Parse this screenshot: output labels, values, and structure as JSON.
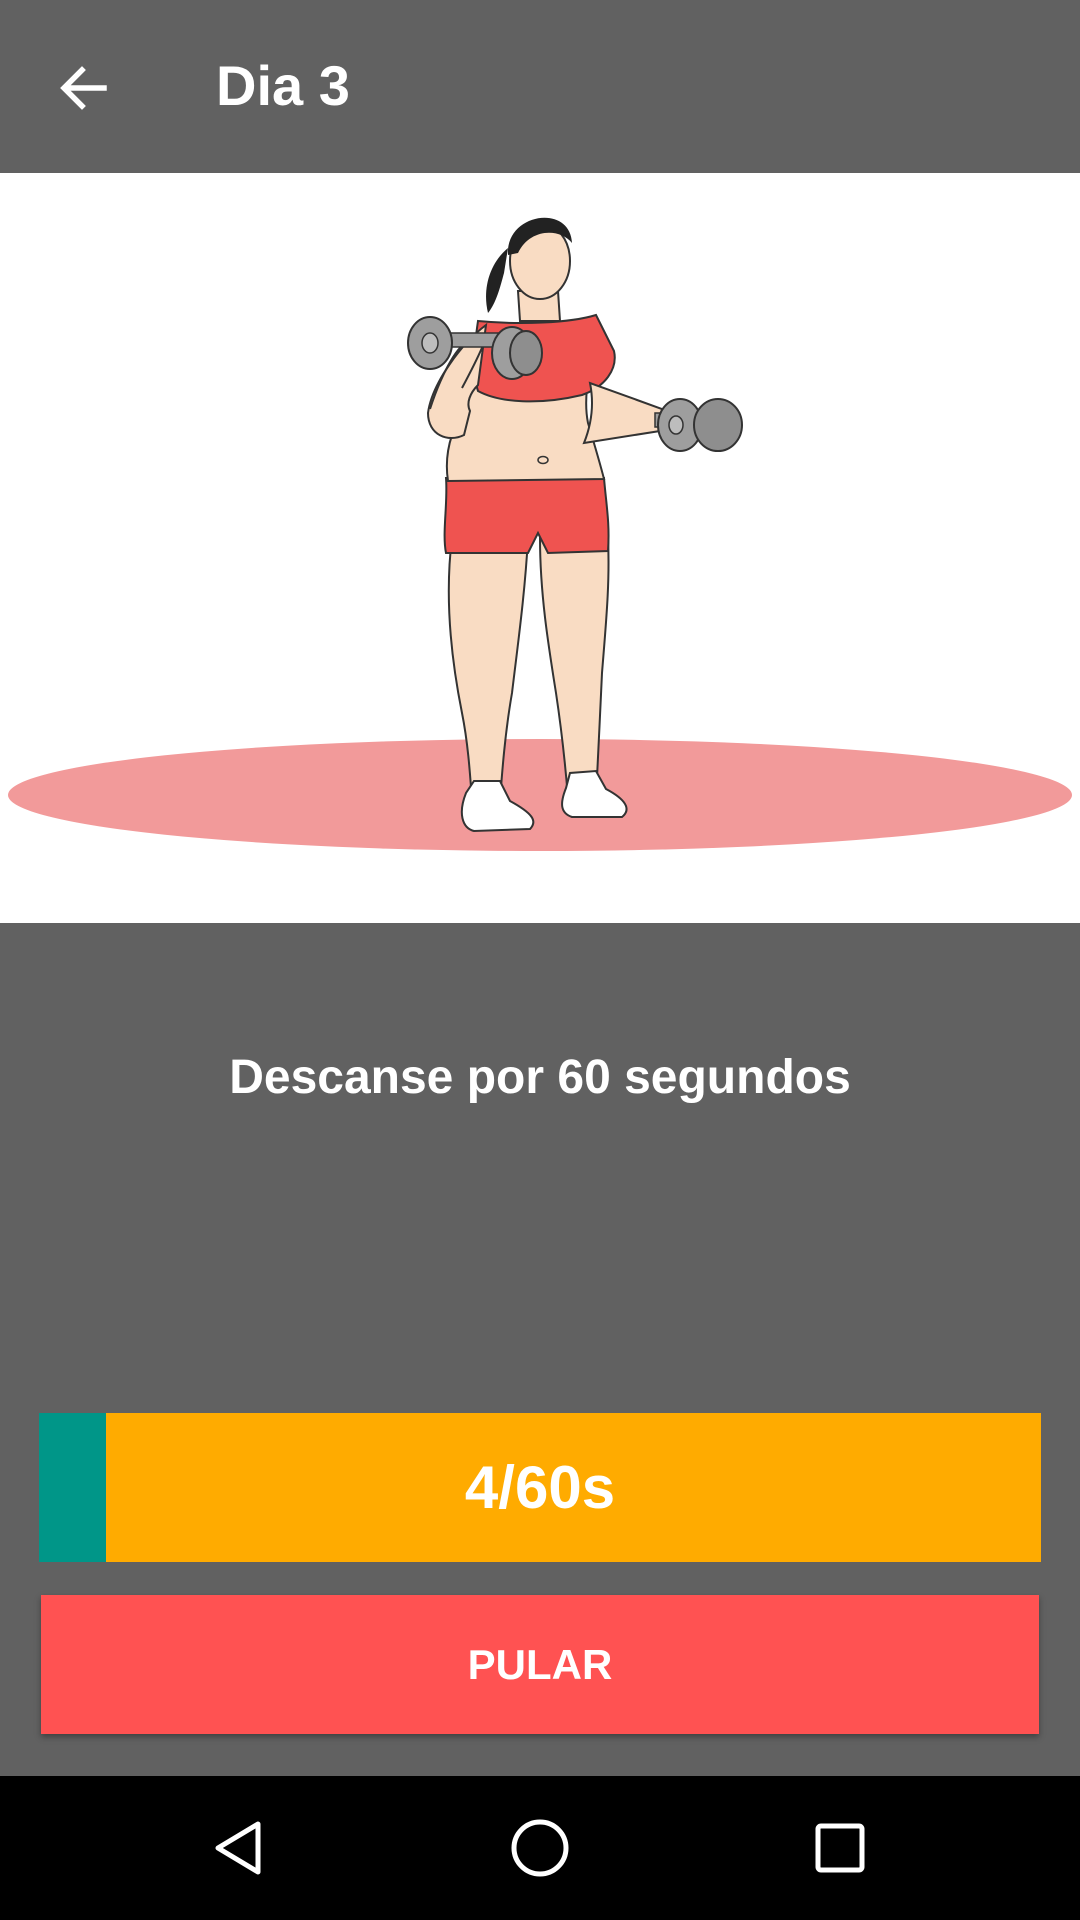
{
  "app_bar": {
    "title": "Dia 3",
    "back_icon": "arrow-left-icon"
  },
  "exercise": {
    "illustration": "woman-dumbbell-curl-illustration",
    "accent_color": "#ef5350",
    "floor_color": "#f29a9a"
  },
  "rest": {
    "message": "Descanse por 60 segundos"
  },
  "timer": {
    "label": "4/60s",
    "elapsed": 4,
    "total": 60,
    "progress_fraction": 0.0667,
    "fill_color": "#009688",
    "track_color": "#ffab00"
  },
  "skip_button": {
    "label": "PULAR",
    "color": "#ff5252"
  },
  "nav_bar": {
    "back_icon": "triangle-back-icon",
    "home_icon": "circle-home-icon",
    "recents_icon": "square-recents-icon"
  }
}
